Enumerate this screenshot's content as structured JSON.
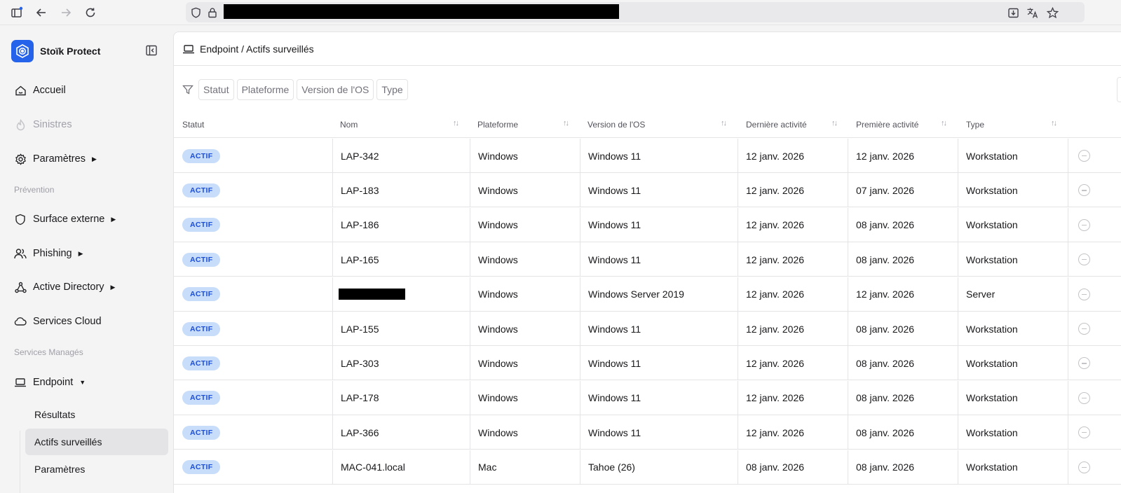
{
  "browser": {
    "icons": [
      "sidebar-icon",
      "back-icon",
      "forward-icon",
      "reload-icon",
      "shield-icon",
      "lock-icon",
      "download-icon",
      "translate-icon",
      "bookmark-star-icon"
    ]
  },
  "sidebar": {
    "brand_name": "Stoïk Protect",
    "items": {
      "accueil": "Accueil",
      "sinistres": "Sinistres",
      "parametres": "Paramètres",
      "surface_externe": "Surface externe",
      "phishing": "Phishing",
      "active_directory": "Active Directory",
      "services_cloud": "Services Cloud",
      "endpoint": "Endpoint"
    },
    "sections": {
      "prevention": "Prévention",
      "services_manages": "Services Managés"
    },
    "endpoint_sub": {
      "resultats": "Résultats",
      "actifs": "Actifs surveillés",
      "parametres": "Paramètres"
    }
  },
  "header": {
    "breadcrumb": "Endpoint / Actifs surveillés"
  },
  "filters": [
    "Statut",
    "Plateforme",
    "Version de l'OS",
    "Type"
  ],
  "table": {
    "columns": {
      "statut": "Statut",
      "nom": "Nom",
      "plateforme": "Plateforme",
      "version": "Version de l'OS",
      "derniere": "Dernière activité",
      "premiere": "Première activité",
      "type": "Type"
    },
    "rows": [
      {
        "statut": "ACTIF",
        "nom": "LAP-342",
        "plateforme": "Windows",
        "version": "Windows 11",
        "derniere": "12 janv. 2026",
        "premiere": "12 janv. 2026",
        "type": "Workstation"
      },
      {
        "statut": "ACTIF",
        "nom": "LAP-183",
        "plateforme": "Windows",
        "version": "Windows 11",
        "derniere": "12 janv. 2026",
        "premiere": "07 janv. 2026",
        "type": "Workstation"
      },
      {
        "statut": "ACTIF",
        "nom": "LAP-186",
        "plateforme": "Windows",
        "version": "Windows 11",
        "derniere": "12 janv. 2026",
        "premiere": "08 janv. 2026",
        "type": "Workstation"
      },
      {
        "statut": "ACTIF",
        "nom": "LAP-165",
        "plateforme": "Windows",
        "version": "Windows 11",
        "derniere": "12 janv. 2026",
        "premiere": "08 janv. 2026",
        "type": "Workstation"
      },
      {
        "statut": "ACTIF",
        "nom": "",
        "plateforme": "Windows",
        "version": "Windows Server 2019",
        "derniere": "12 janv. 2026",
        "premiere": "12 janv. 2026",
        "type": "Server"
      },
      {
        "statut": "ACTIF",
        "nom": "LAP-155",
        "plateforme": "Windows",
        "version": "Windows 11",
        "derniere": "12 janv. 2026",
        "premiere": "08 janv. 2026",
        "type": "Workstation"
      },
      {
        "statut": "ACTIF",
        "nom": "LAP-303",
        "plateforme": "Windows",
        "version": "Windows 11",
        "derniere": "12 janv. 2026",
        "premiere": "08 janv. 2026",
        "type": "Workstation"
      },
      {
        "statut": "ACTIF",
        "nom": "LAP-178",
        "plateforme": "Windows",
        "version": "Windows 11",
        "derniere": "12 janv. 2026",
        "premiere": "08 janv. 2026",
        "type": "Workstation"
      },
      {
        "statut": "ACTIF",
        "nom": "LAP-366",
        "plateforme": "Windows",
        "version": "Windows 11",
        "derniere": "12 janv. 2026",
        "premiere": "08 janv. 2026",
        "type": "Workstation"
      },
      {
        "statut": "ACTIF",
        "nom": "MAC-041.local",
        "plateforme": "Mac",
        "version": "Tahoe (26)",
        "derniere": "08 janv. 2026",
        "premiere": "08 janv. 2026",
        "type": "Workstation"
      }
    ]
  },
  "colors": {
    "brand": "#2563eb",
    "badge_bg": "#c7ddf9",
    "badge_text": "#1d4ed8",
    "active_nav_bg": "#e4e4e7"
  }
}
